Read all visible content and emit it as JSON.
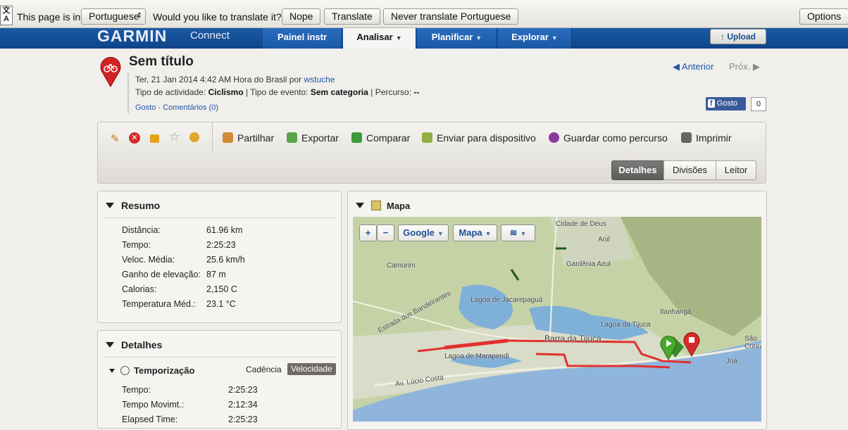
{
  "translate_bar": {
    "prefix": "This page is in",
    "language": "Portuguese",
    "question": "Would you like to translate it?",
    "nope": "Nope",
    "translate": "Translate",
    "never": "Never translate Portuguese",
    "options": "Options"
  },
  "nav": {
    "logo": "GARMIN",
    "logo_sub": "Connect",
    "tabs": [
      {
        "label": "Painel instr"
      },
      {
        "label": "Analisar"
      },
      {
        "label": "Planificar"
      },
      {
        "label": "Explorar"
      }
    ],
    "upload": "↑ Upload"
  },
  "activity": {
    "title": "Sem título",
    "date": "Ter, 21 Jan 2014 4:42 AM Hora do Brasil por",
    "user": "wstuche",
    "type_label": "Tipo de actividade:",
    "type_value": "Ciclismo",
    "event_label": "Tipo de evento:",
    "event_value": "Sem categoria",
    "course_label": "Percurso:",
    "course_value": "--",
    "like": "Gosto",
    "comments": "Comentários (0)"
  },
  "pager": {
    "prev": "Anterior",
    "next": "Próx."
  },
  "facebook": {
    "label": "Gosto",
    "count": "0"
  },
  "toolbar": {
    "share": "Partilhar",
    "export": "Exportar",
    "compare": "Comparar",
    "send": "Enviar para dispositivo",
    "save_course": "Guardar como percurso",
    "print": "Imprimir",
    "views": [
      "Detalhes",
      "Divisões",
      "Leitor"
    ]
  },
  "summary": {
    "title": "Resumo",
    "rows": [
      {
        "label": "Distância:",
        "value": "61.96 km"
      },
      {
        "label": "Tempo:",
        "value": "2:25:23"
      },
      {
        "label": "Veloc. Média:",
        "value": "25.6 km/h"
      },
      {
        "label": "Ganho de elevação:",
        "value": "87 m"
      },
      {
        "label": "Calorias:",
        "value": "2,150 C"
      },
      {
        "label": "Temperatura Méd.:",
        "value": "23.1 °C"
      }
    ]
  },
  "details": {
    "title": "Detalhes",
    "timing": "Temporização",
    "cadence": "Cadência",
    "speed": "Velocidade",
    "rows": [
      {
        "label": "Tempo:",
        "value": "2:25:23"
      },
      {
        "label": "Tempo Movimt.:",
        "value": "2:12:34"
      },
      {
        "label": "Elapsed Time:",
        "value": "2:25:23"
      }
    ]
  },
  "map": {
    "title": "Mapa",
    "provider": "Google",
    "type": "Mapa",
    "labels": [
      "Cidade de Deus",
      "Anil",
      "Gardênia Azul",
      "Camorim",
      "Lagoa de Jacarepaguá",
      "Estrada dos Bandeirantes",
      "Barra da Tijuca",
      "Lagoa da Tijuca",
      "Itanhangá",
      "Lagoa de Marapendi",
      "Av. Lúcio Costa",
      "Joá",
      "São Conrado"
    ]
  }
}
